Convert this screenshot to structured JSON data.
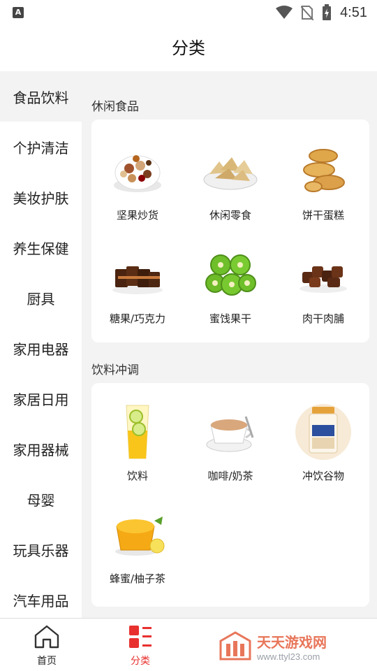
{
  "status_bar": {
    "time": "4:51",
    "notification_letter": "A"
  },
  "header": {
    "title": "分类"
  },
  "sidebar": {
    "items": [
      {
        "label": "食品饮料",
        "active": true
      },
      {
        "label": "个护清洁",
        "active": false
      },
      {
        "label": "美妆护肤",
        "active": false
      },
      {
        "label": "养生保健",
        "active": false
      },
      {
        "label": "厨具",
        "active": false
      },
      {
        "label": "家用电器",
        "active": false
      },
      {
        "label": "家居日用",
        "active": false
      },
      {
        "label": "家用器械",
        "active": false
      },
      {
        "label": "母婴",
        "active": false
      },
      {
        "label": "玩具乐器",
        "active": false
      },
      {
        "label": "汽车用品",
        "active": false
      }
    ]
  },
  "sections": [
    {
      "title": "休闲食品",
      "items": [
        {
          "label": "坚果炒货",
          "icon": "nuts-image"
        },
        {
          "label": "休闲零食",
          "icon": "chips-image"
        },
        {
          "label": "饼干蛋糕",
          "icon": "cookies-image"
        },
        {
          "label": "糖果/巧克力",
          "icon": "chocolate-image"
        },
        {
          "label": "蜜饯果干",
          "icon": "dried-kiwi-image"
        },
        {
          "label": "肉干肉脯",
          "icon": "jerky-image"
        }
      ]
    },
    {
      "title": "饮料冲调",
      "items": [
        {
          "label": "饮料",
          "icon": "lemon-drink-image"
        },
        {
          "label": "咖啡/奶茶",
          "icon": "coffee-image"
        },
        {
          "label": "冲饮谷物",
          "icon": "oat-jar-image"
        },
        {
          "label": "蜂蜜/柚子茶",
          "icon": "honey-citron-image"
        }
      ]
    }
  ],
  "bottom_nav": {
    "home_label": "首页",
    "category_label": "分类",
    "accent_color": "#e8312f"
  },
  "watermark": {
    "title": "天天游戏网",
    "url": "www.ttyl23.com"
  }
}
